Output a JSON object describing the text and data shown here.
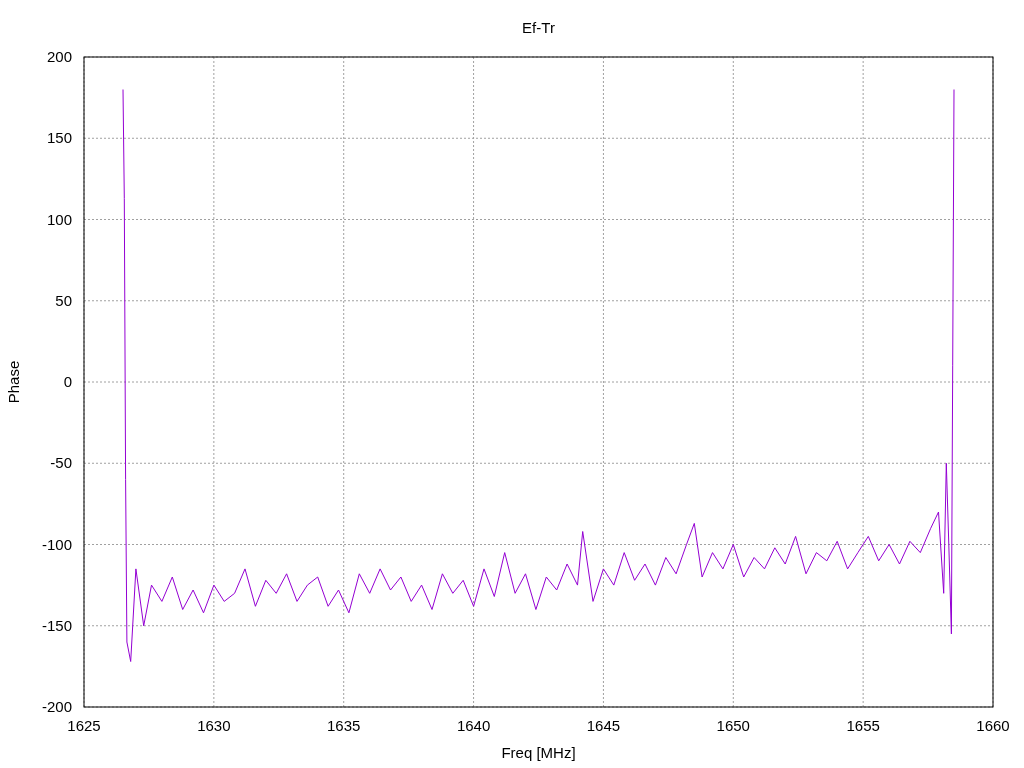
{
  "chart_data": {
    "type": "line",
    "title": "Ef-Tr",
    "xlabel": "Freq [MHz]",
    "ylabel": "Phase",
    "x": [
      1626.5,
      1626.55,
      1626.6,
      1626.65,
      1626.8,
      1627.0,
      1627.3,
      1627.6,
      1628.0,
      1628.4,
      1628.8,
      1629.2,
      1629.6,
      1630.0,
      1630.4,
      1630.8,
      1631.2,
      1631.6,
      1632.0,
      1632.4,
      1632.8,
      1633.2,
      1633.6,
      1634.0,
      1634.4,
      1634.8,
      1635.2,
      1635.6,
      1636.0,
      1636.4,
      1636.8,
      1637.2,
      1637.6,
      1638.0,
      1638.4,
      1638.8,
      1639.2,
      1639.6,
      1640.0,
      1640.4,
      1640.8,
      1641.2,
      1641.6,
      1642.0,
      1642.4,
      1642.8,
      1643.2,
      1643.6,
      1644.0,
      1644.2,
      1644.6,
      1645.0,
      1645.4,
      1645.8,
      1646.2,
      1646.6,
      1647.0,
      1647.4,
      1647.8,
      1648.2,
      1648.5,
      1648.8,
      1649.2,
      1649.6,
      1650.0,
      1650.4,
      1650.8,
      1651.2,
      1651.6,
      1652.0,
      1652.4,
      1652.8,
      1653.2,
      1653.6,
      1654.0,
      1654.4,
      1654.8,
      1655.2,
      1655.6,
      1656.0,
      1656.4,
      1656.8,
      1657.2,
      1657.6,
      1657.9,
      1658.1,
      1658.2,
      1658.3,
      1658.4,
      1658.45,
      1658.5
    ],
    "series": [
      {
        "color": "#9400d3",
        "values": [
          180,
          113,
          -60,
          -160,
          -172,
          -115,
          -150,
          -125,
          -135,
          -120,
          -140,
          -128,
          -142,
          -125,
          -135,
          -130,
          -115,
          -138,
          -122,
          -130,
          -118,
          -135,
          -125,
          -120,
          -138,
          -128,
          -142,
          -118,
          -130,
          -115,
          -128,
          -120,
          -135,
          -125,
          -140,
          -118,
          -130,
          -122,
          -138,
          -115,
          -132,
          -105,
          -130,
          -118,
          -140,
          -120,
          -128,
          -112,
          -125,
          -92,
          -135,
          -115,
          -125,
          -105,
          -122,
          -112,
          -125,
          -108,
          -118,
          -100,
          -87,
          -120,
          -105,
          -115,
          -100,
          -120,
          -108,
          -115,
          -102,
          -112,
          -95,
          -118,
          -105,
          -110,
          -98,
          -115,
          -105,
          -95,
          -110,
          -100,
          -112,
          -98,
          -105,
          -90,
          -80,
          -130,
          -50,
          -100,
          -155,
          10,
          180
        ]
      }
    ],
    "grid": true,
    "xlim": [
      1625,
      1660
    ],
    "ylim": [
      -200,
      200
    ],
    "xticks": [
      1625,
      1630,
      1635,
      1640,
      1645,
      1650,
      1655,
      1660
    ],
    "yticks": [
      -200,
      -150,
      -100,
      -50,
      0,
      50,
      100,
      150,
      200
    ]
  }
}
